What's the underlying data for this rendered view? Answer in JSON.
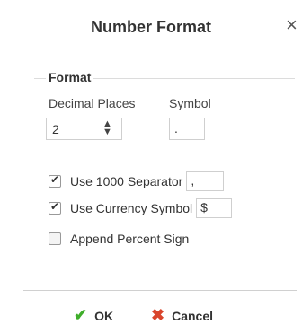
{
  "dialog": {
    "title": "Number Format",
    "close_glyph": "×",
    "section_title": "Format",
    "decimal_places_label": "Decimal Places",
    "decimal_places_value": "2",
    "spinner_glyph": "▲▼",
    "symbol_label": "Symbol",
    "symbol_value": ".",
    "options": [
      {
        "label": "Use 1000 Separator",
        "checked": true,
        "input_value": ","
      },
      {
        "label": "Use Currency Symbol",
        "checked": true,
        "input_value": "$"
      },
      {
        "label": "Append Percent Sign",
        "checked": false
      }
    ],
    "ok": {
      "label": "OK",
      "icon": "checkmark-icon",
      "glyph": "✔",
      "color": "#3fae2a"
    },
    "cancel": {
      "label": "Cancel",
      "icon": "x-icon",
      "glyph": "✖",
      "color": "#d9452c"
    }
  }
}
